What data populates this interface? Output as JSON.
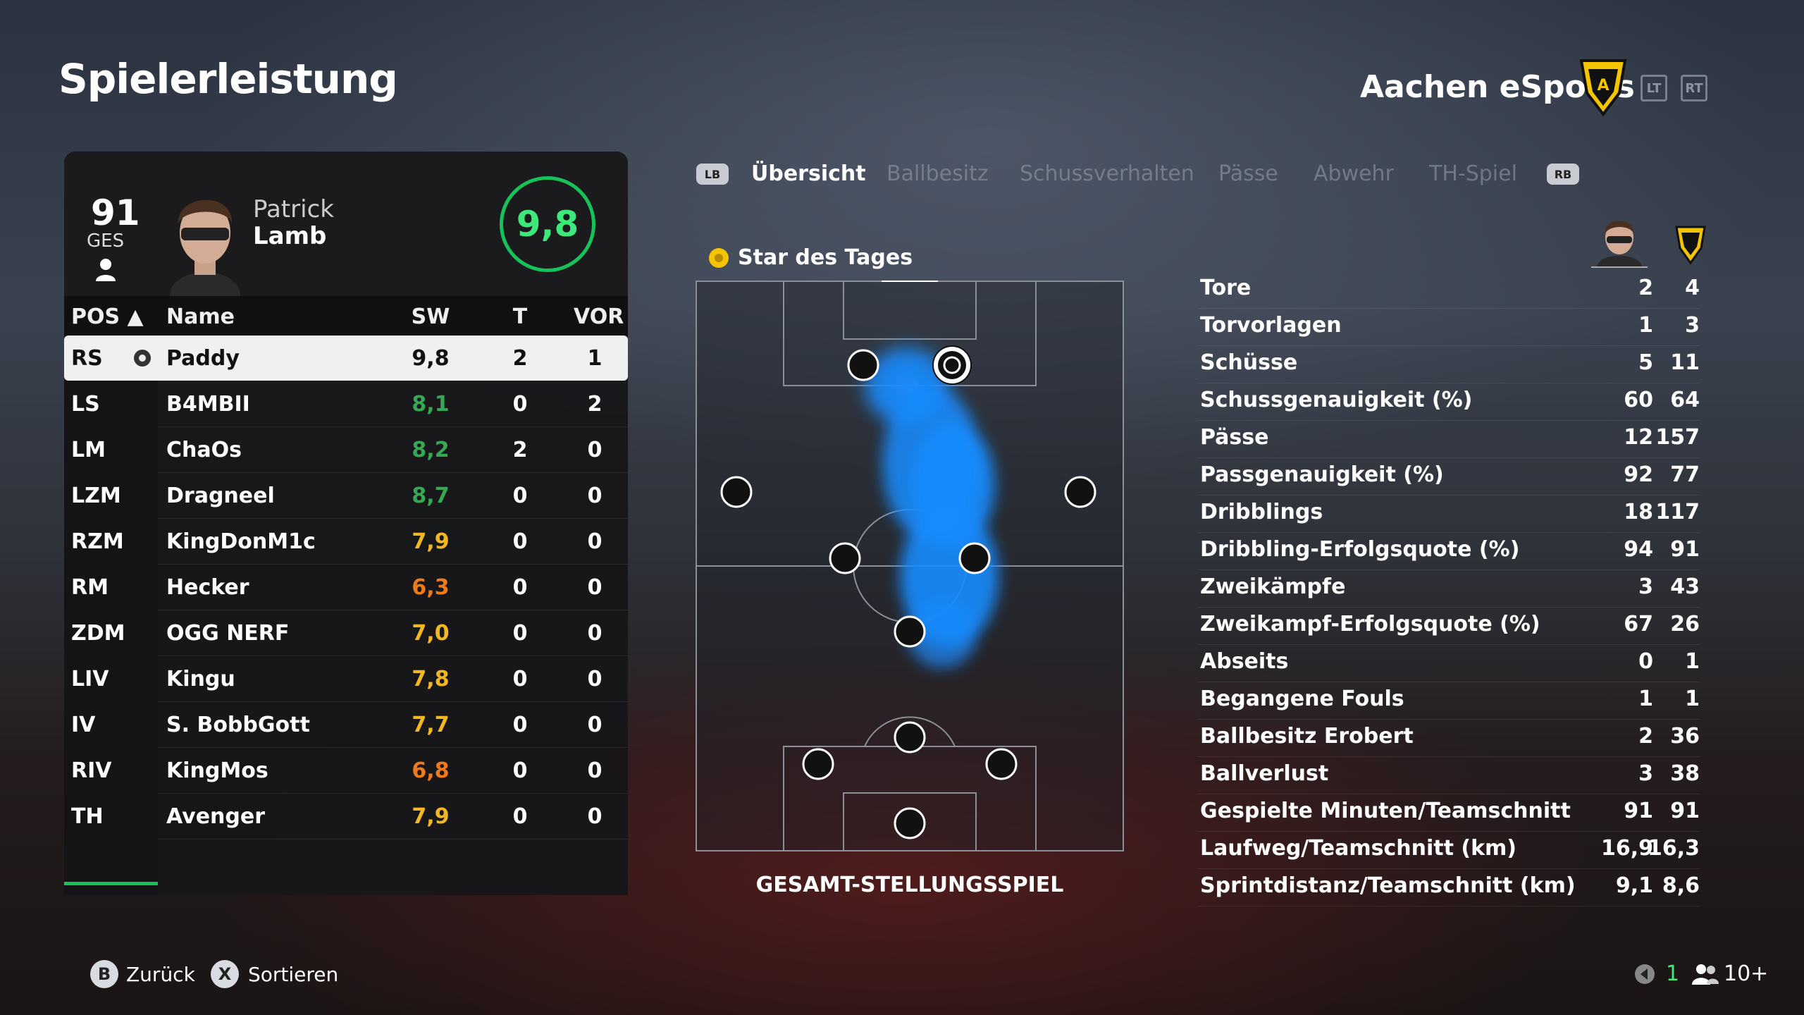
{
  "page_title": "Spielerleistung",
  "team": {
    "name": "Aachen eSports",
    "crest_text": "A",
    "trigger_left": "LT",
    "trigger_right": "RT"
  },
  "player": {
    "overall": "91",
    "overall_label": "GES",
    "first_name": "Patrick",
    "last_name": "Lamb",
    "rating": "9,8"
  },
  "table": {
    "headers": {
      "pos": "POS ▲",
      "name": "Name",
      "sw": "SW",
      "t": "T",
      "vor": "VOR"
    },
    "rows": [
      {
        "pos": "RS",
        "name": "Paddy",
        "sw": "9,8",
        "t": "2",
        "vor": "1",
        "sw_color": "#111111",
        "selected": true
      },
      {
        "pos": "LS",
        "name": "B4MBII",
        "sw": "8,1",
        "t": "0",
        "vor": "2",
        "sw_color": "#34a853"
      },
      {
        "pos": "LM",
        "name": "ChaOs",
        "sw": "8,2",
        "t": "2",
        "vor": "0",
        "sw_color": "#34a853"
      },
      {
        "pos": "LZM",
        "name": "Dragneel",
        "sw": "8,7",
        "t": "0",
        "vor": "0",
        "sw_color": "#34a853"
      },
      {
        "pos": "RZM",
        "name": "KingDonM1c",
        "sw": "7,9",
        "t": "0",
        "vor": "0",
        "sw_color": "#f2b822"
      },
      {
        "pos": "RM",
        "name": "Hecker",
        "sw": "6,3",
        "t": "0",
        "vor": "0",
        "sw_color": "#f07a1a"
      },
      {
        "pos": "ZDM",
        "name": "OGG NERF",
        "sw": "7,0",
        "t": "0",
        "vor": "0",
        "sw_color": "#f2b822"
      },
      {
        "pos": "LIV",
        "name": "Kingu",
        "sw": "7,8",
        "t": "0",
        "vor": "0",
        "sw_color": "#f2b822"
      },
      {
        "pos": "IV",
        "name": "S. BobbGott",
        "sw": "7,7",
        "t": "0",
        "vor": "0",
        "sw_color": "#f2b822"
      },
      {
        "pos": "RIV",
        "name": "KingMos",
        "sw": "6,8",
        "t": "0",
        "vor": "0",
        "sw_color": "#f07a1a"
      },
      {
        "pos": "TH",
        "name": "Avenger",
        "sw": "7,9",
        "t": "0",
        "vor": "0",
        "sw_color": "#f2b822"
      }
    ]
  },
  "tabs": {
    "lb": "LB",
    "rb": "RB",
    "items": [
      "Übersicht",
      "Ballbesitz",
      "Schussverhalten",
      "Pässe",
      "Abwehr",
      "TH-Spiel"
    ],
    "active": "Übersicht"
  },
  "pitch": {
    "star_label": "Star des Tages",
    "caption": "GESAMT-STELLUNGSSPIEL"
  },
  "stats": [
    {
      "label": "Tore",
      "player": "2",
      "team": "4"
    },
    {
      "label": "Torvorlagen",
      "player": "1",
      "team": "3"
    },
    {
      "label": "Schüsse",
      "player": "5",
      "team": "11"
    },
    {
      "label": "Schussgenauigkeit (%)",
      "player": "60",
      "team": "64"
    },
    {
      "label": "Pässe",
      "player": "12",
      "team": "157"
    },
    {
      "label": "Passgenauigkeit (%)",
      "player": "92",
      "team": "77"
    },
    {
      "label": "Dribblings",
      "player": "18",
      "team": "117"
    },
    {
      "label": "Dribbling-Erfolgsquote (%)",
      "player": "94",
      "team": "91"
    },
    {
      "label": "Zweikämpfe",
      "player": "3",
      "team": "43"
    },
    {
      "label": "Zweikampf-Erfolgsquote (%)",
      "player": "67",
      "team": "26"
    },
    {
      "label": "Abseits",
      "player": "0",
      "team": "1"
    },
    {
      "label": "Begangene Fouls",
      "player": "1",
      "team": "1"
    },
    {
      "label": "Ballbesitz Erobert",
      "player": "2",
      "team": "36"
    },
    {
      "label": "Ballverlust",
      "player": "3",
      "team": "38"
    },
    {
      "label": "Gespielte Minuten/Teamschnitt",
      "player": "91",
      "team": "91"
    },
    {
      "label": "Laufweg/Teamschnitt (km)",
      "player": "16,9",
      "team": "16,3"
    },
    {
      "label": "Sprintdistanz/Teamschnitt (km)",
      "player": "9,1",
      "team": "8,6"
    }
  ],
  "footer": {
    "back_key": "B",
    "back_label": "Zurück",
    "sort_key": "X",
    "sort_label": "Sortieren",
    "notif_count": "1",
    "players_count": "10+"
  },
  "colors": {
    "accent_green": "#18c25a",
    "rating_text": "#3ee87a",
    "heatmap_blue": "#1a8cff"
  }
}
